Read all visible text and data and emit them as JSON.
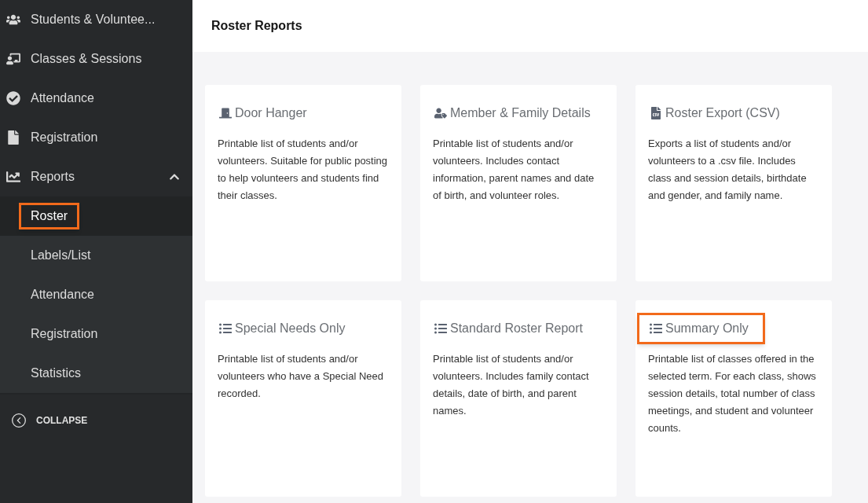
{
  "sidebar": {
    "items": [
      {
        "label": "Students & Voluntee..."
      },
      {
        "label": "Classes & Sessions"
      },
      {
        "label": "Attendance"
      },
      {
        "label": "Registration"
      },
      {
        "label": "Reports",
        "expanded": true,
        "children": [
          {
            "label": "Roster",
            "selected": true,
            "highlighted": true
          },
          {
            "label": "Labels/List",
            "selected": false,
            "highlighted": false
          },
          {
            "label": "Attendance",
            "selected": false,
            "highlighted": false
          },
          {
            "label": "Registration",
            "selected": false,
            "highlighted": false
          },
          {
            "label": "Statistics",
            "selected": false,
            "highlighted": false
          }
        ]
      }
    ],
    "collapse": "COLLAPSE"
  },
  "header": {
    "title": "Roster Reports"
  },
  "cards": [
    {
      "kind": "door",
      "title": "Door Hanger",
      "highlighted": false,
      "description": "Printable list of students and/or volunteers. Suitable for public posting to help volunteers and students find their classes."
    },
    {
      "kind": "member",
      "title": "Member & Family Details",
      "highlighted": false,
      "description": "Printable list of students and/or volunteers. Includes contact information, parent names and date of birth, and volunteer roles."
    },
    {
      "kind": "csv",
      "title": "Roster Export (CSV)",
      "highlighted": false,
      "description": "Exports a list of students and/or volunteers to a .csv file. Includes class and session details, birthdate and gender, and family name."
    },
    {
      "kind": "list",
      "title": "Special Needs Only",
      "highlighted": false,
      "description": "Printable list of students and/or volunteers who have a Special Need recorded."
    },
    {
      "kind": "list",
      "title": "Standard Roster Report",
      "highlighted": false,
      "description": "Printable list of students and/or volunteers. Includes family contact details, date of birth, and parent names."
    },
    {
      "kind": "list",
      "title": "Summary Only",
      "highlighted": true,
      "description": "Printable list of classes offered in the selected term. For each class, shows session details, total number of class meetings, and student and volunteer counts."
    }
  ]
}
